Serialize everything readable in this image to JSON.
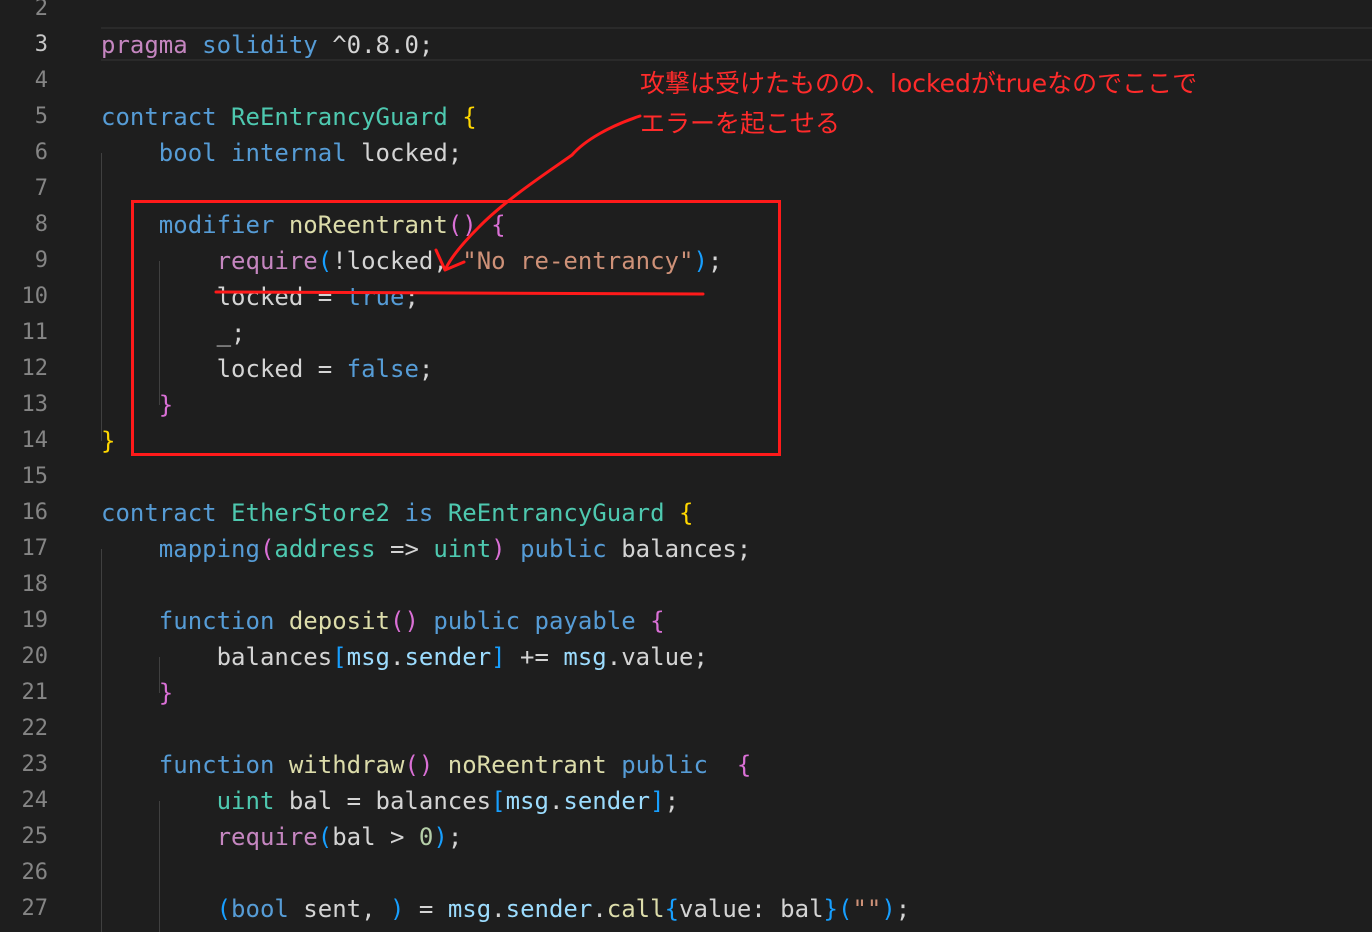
{
  "editor": {
    "active_line": 3,
    "lines": [
      {
        "n": "2",
        "tokens": []
      },
      {
        "n": "3",
        "tokens": [
          [
            "t-ctl",
            "pragma"
          ],
          [
            "t-plain",
            " "
          ],
          [
            "t-kw",
            "solidity"
          ],
          [
            "t-plain",
            " ^0.8.0;"
          ]
        ]
      },
      {
        "n": "4",
        "tokens": []
      },
      {
        "n": "5",
        "tokens": [
          [
            "t-kw",
            "contract"
          ],
          [
            "t-plain",
            " "
          ],
          [
            "t-type",
            "ReEntrancyGuard"
          ],
          [
            "t-plain",
            " "
          ],
          [
            "t-br1",
            "{"
          ]
        ]
      },
      {
        "n": "6",
        "tokens": [
          [
            "t-plain",
            "    "
          ],
          [
            "t-kw",
            "bool"
          ],
          [
            "t-plain",
            " "
          ],
          [
            "t-kw",
            "internal"
          ],
          [
            "t-plain",
            " locked;"
          ]
        ]
      },
      {
        "n": "7",
        "tokens": []
      },
      {
        "n": "8",
        "tokens": [
          [
            "t-plain",
            "    "
          ],
          [
            "t-kw",
            "modifier"
          ],
          [
            "t-plain",
            " "
          ],
          [
            "t-fn",
            "noReentrant"
          ],
          [
            "t-br2",
            "()"
          ],
          [
            "t-plain",
            " "
          ],
          [
            "t-br2",
            "{"
          ]
        ]
      },
      {
        "n": "9",
        "tokens": [
          [
            "t-plain",
            "        "
          ],
          [
            "t-ctl",
            "require"
          ],
          [
            "t-br3",
            "("
          ],
          [
            "t-plain",
            "!locked, "
          ],
          [
            "t-str",
            "\"No re-entrancy\""
          ],
          [
            "t-br3",
            ")"
          ],
          [
            "t-plain",
            ";"
          ]
        ]
      },
      {
        "n": "10",
        "tokens": [
          [
            "t-plain",
            "        locked = "
          ],
          [
            "t-kw",
            "true"
          ],
          [
            "t-plain",
            ";"
          ]
        ]
      },
      {
        "n": "11",
        "tokens": [
          [
            "t-plain",
            "        _;"
          ]
        ]
      },
      {
        "n": "12",
        "tokens": [
          [
            "t-plain",
            "        locked = "
          ],
          [
            "t-kw",
            "false"
          ],
          [
            "t-plain",
            ";"
          ]
        ]
      },
      {
        "n": "13",
        "tokens": [
          [
            "t-plain",
            "    "
          ],
          [
            "t-br2",
            "}"
          ]
        ]
      },
      {
        "n": "14",
        "tokens": [
          [
            "t-br1",
            "}"
          ]
        ]
      },
      {
        "n": "15",
        "tokens": []
      },
      {
        "n": "16",
        "tokens": [
          [
            "t-kw",
            "contract"
          ],
          [
            "t-plain",
            " "
          ],
          [
            "t-type",
            "EtherStore2"
          ],
          [
            "t-plain",
            " "
          ],
          [
            "t-kw",
            "is"
          ],
          [
            "t-plain",
            " "
          ],
          [
            "t-type",
            "ReEntrancyGuard"
          ],
          [
            "t-plain",
            " "
          ],
          [
            "t-br1",
            "{"
          ]
        ]
      },
      {
        "n": "17",
        "tokens": [
          [
            "t-plain",
            "    "
          ],
          [
            "t-kw",
            "mapping"
          ],
          [
            "t-br2",
            "("
          ],
          [
            "t-type",
            "address"
          ],
          [
            "t-plain",
            " => "
          ],
          [
            "t-type",
            "uint"
          ],
          [
            "t-br2",
            ")"
          ],
          [
            "t-plain",
            " "
          ],
          [
            "t-kw",
            "public"
          ],
          [
            "t-plain",
            " balances;"
          ]
        ]
      },
      {
        "n": "18",
        "tokens": []
      },
      {
        "n": "19",
        "tokens": [
          [
            "t-plain",
            "    "
          ],
          [
            "t-kw",
            "function"
          ],
          [
            "t-plain",
            " "
          ],
          [
            "t-fn",
            "deposit"
          ],
          [
            "t-br2",
            "()"
          ],
          [
            "t-plain",
            " "
          ],
          [
            "t-kw",
            "public"
          ],
          [
            "t-plain",
            " "
          ],
          [
            "t-kw",
            "payable"
          ],
          [
            "t-plain",
            " "
          ],
          [
            "t-br2",
            "{"
          ]
        ]
      },
      {
        "n": "20",
        "tokens": [
          [
            "t-plain",
            "        balances"
          ],
          [
            "t-br3",
            "["
          ],
          [
            "t-var",
            "msg"
          ],
          [
            "t-plain",
            "."
          ],
          [
            "t-var",
            "sender"
          ],
          [
            "t-br3",
            "]"
          ],
          [
            "t-plain",
            " += "
          ],
          [
            "t-var",
            "msg"
          ],
          [
            "t-plain",
            ".value;"
          ]
        ]
      },
      {
        "n": "21",
        "tokens": [
          [
            "t-plain",
            "    "
          ],
          [
            "t-br2",
            "}"
          ]
        ]
      },
      {
        "n": "22",
        "tokens": []
      },
      {
        "n": "23",
        "tokens": [
          [
            "t-plain",
            "    "
          ],
          [
            "t-kw",
            "function"
          ],
          [
            "t-plain",
            " "
          ],
          [
            "t-fn",
            "withdraw"
          ],
          [
            "t-br2",
            "()"
          ],
          [
            "t-plain",
            " "
          ],
          [
            "t-fn",
            "noReentrant"
          ],
          [
            "t-plain",
            " "
          ],
          [
            "t-kw",
            "public"
          ],
          [
            "t-plain",
            "  "
          ],
          [
            "t-br2",
            "{"
          ]
        ]
      },
      {
        "n": "24",
        "tokens": [
          [
            "t-plain",
            "        "
          ],
          [
            "t-type",
            "uint"
          ],
          [
            "t-plain",
            " bal = balances"
          ],
          [
            "t-br3",
            "["
          ],
          [
            "t-var",
            "msg"
          ],
          [
            "t-plain",
            "."
          ],
          [
            "t-var",
            "sender"
          ],
          [
            "t-br3",
            "]"
          ],
          [
            "t-plain",
            ";"
          ]
        ]
      },
      {
        "n": "25",
        "tokens": [
          [
            "t-plain",
            "        "
          ],
          [
            "t-ctl",
            "require"
          ],
          [
            "t-br3",
            "("
          ],
          [
            "t-plain",
            "bal > "
          ],
          [
            "t-num",
            "0"
          ],
          [
            "t-br3",
            ")"
          ],
          [
            "t-plain",
            ";"
          ]
        ]
      },
      {
        "n": "26",
        "tokens": []
      },
      {
        "n": "27",
        "tokens": [
          [
            "t-plain",
            "        "
          ],
          [
            "t-br3",
            "("
          ],
          [
            "t-kw",
            "bool"
          ],
          [
            "t-plain",
            " sent, "
          ],
          [
            "t-br3",
            ")"
          ],
          [
            "t-plain",
            " = "
          ],
          [
            "t-var",
            "msg"
          ],
          [
            "t-plain",
            "."
          ],
          [
            "t-var",
            "sender"
          ],
          [
            "t-plain",
            "."
          ],
          [
            "t-fn",
            "call"
          ],
          [
            "t-br3",
            "{"
          ],
          [
            "t-plain",
            "value: bal"
          ],
          [
            "t-br3",
            "}"
          ],
          [
            "t-br3",
            "("
          ],
          [
            "t-str",
            "\"\""
          ],
          [
            "t-br3",
            ")"
          ],
          [
            "t-plain",
            ";"
          ]
        ]
      }
    ]
  },
  "annotation": {
    "text_line1": "攻撃は受けたものの、lockedがtrueなのでここで",
    "text_line2": "エラーを起こせる",
    "color": "#ff1a1a"
  }
}
